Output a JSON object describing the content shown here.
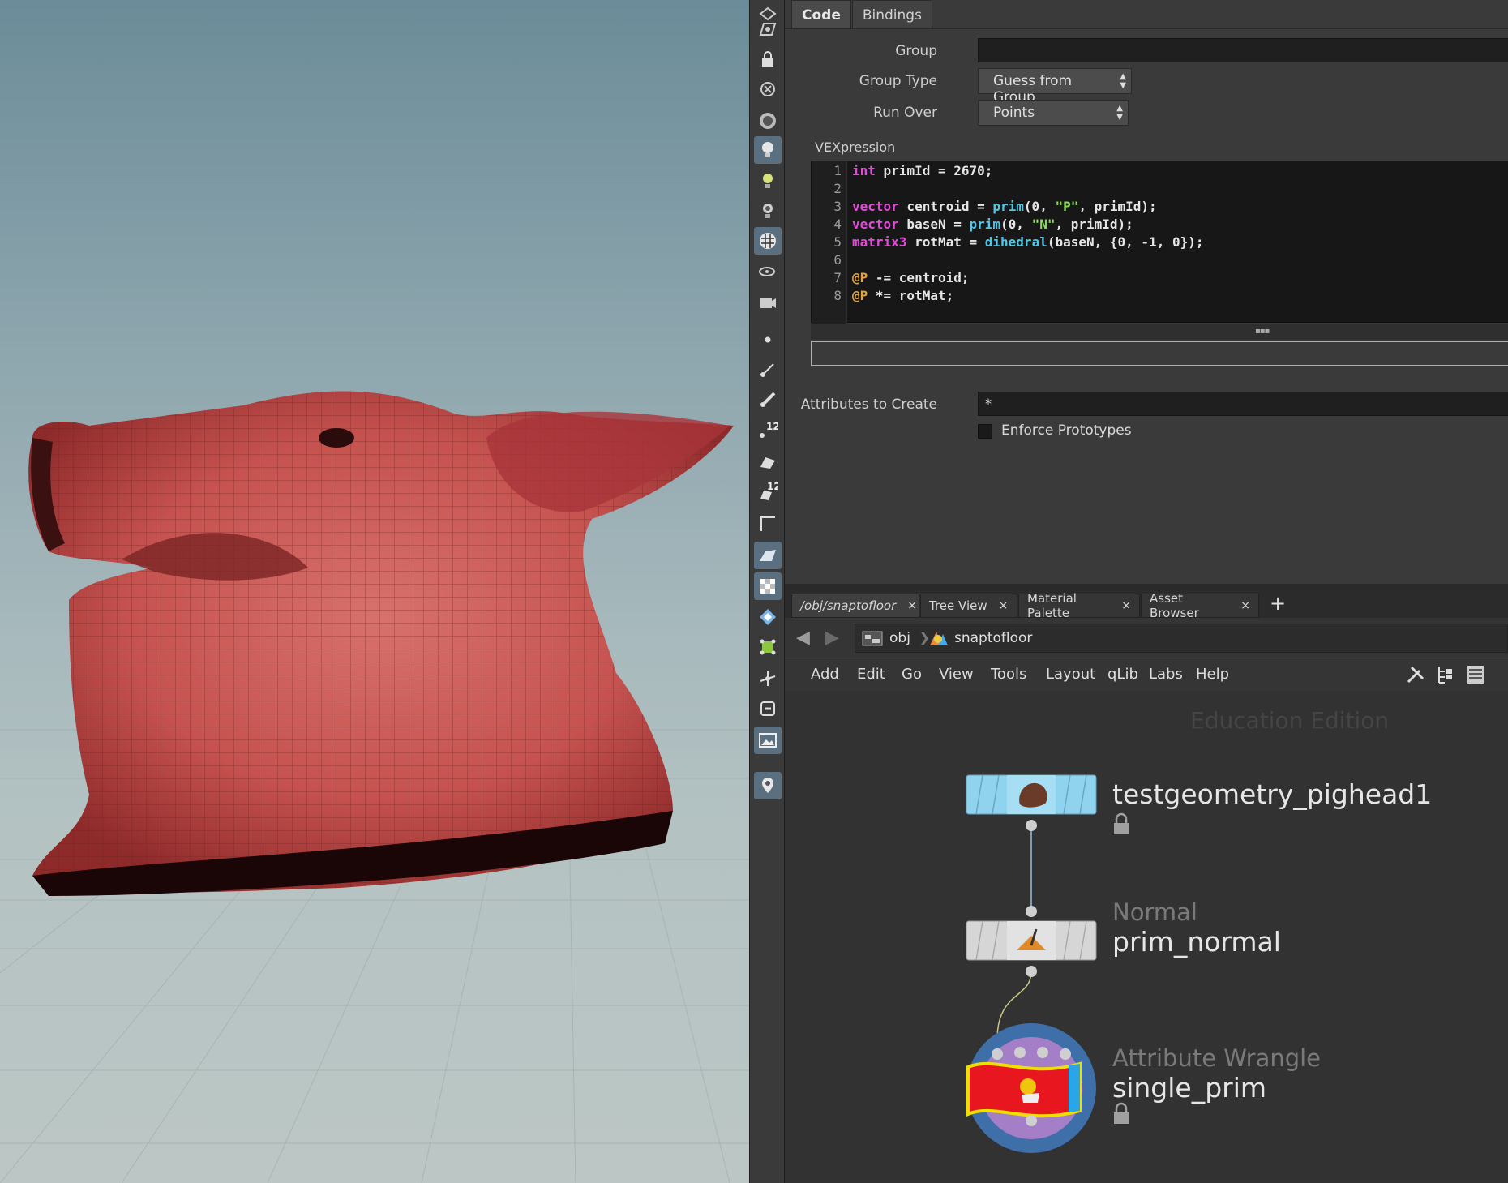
{
  "params": {
    "tabs": [
      "Code",
      "Bindings"
    ],
    "group_label": "Group",
    "group_value": "",
    "group_type_label": "Group Type",
    "group_type_value": "Guess from Group",
    "run_over_label": "Run Over",
    "run_over_value": "Points",
    "vexpression_label": "VEXpression",
    "code_lines": [
      "1",
      "2",
      "3",
      "4",
      "5",
      "6",
      "7",
      "8"
    ],
    "attributes_label": "Attributes to Create",
    "attributes_value": "*",
    "enforce_label": "Enforce Prototypes"
  },
  "network": {
    "tabs": [
      {
        "label": "/obj/snaptofloor"
      },
      {
        "label": "Tree View"
      },
      {
        "label": "Material Palette"
      },
      {
        "label": "Asset Browser"
      }
    ],
    "path": [
      "obj",
      "snaptofloor"
    ],
    "menus": [
      "Add",
      "Edit",
      "Go",
      "View",
      "Tools",
      "Layout",
      "qLib",
      "Labs",
      "Help"
    ],
    "watermark": "Education Edition",
    "nodes": [
      {
        "name": "testgeometry_pighead1",
        "type": ""
      },
      {
        "name": "prim_normal",
        "type": "Normal"
      },
      {
        "name": "single_prim",
        "type": "Attribute Wrangle"
      }
    ]
  },
  "colors": {
    "keyword": "#e04bd8",
    "function": "#4fc7e6",
    "string": "#8bde59",
    "attribute": "#e3a33a",
    "test_node": "#8fd3ef",
    "wrangle_red": "#e8161f"
  }
}
